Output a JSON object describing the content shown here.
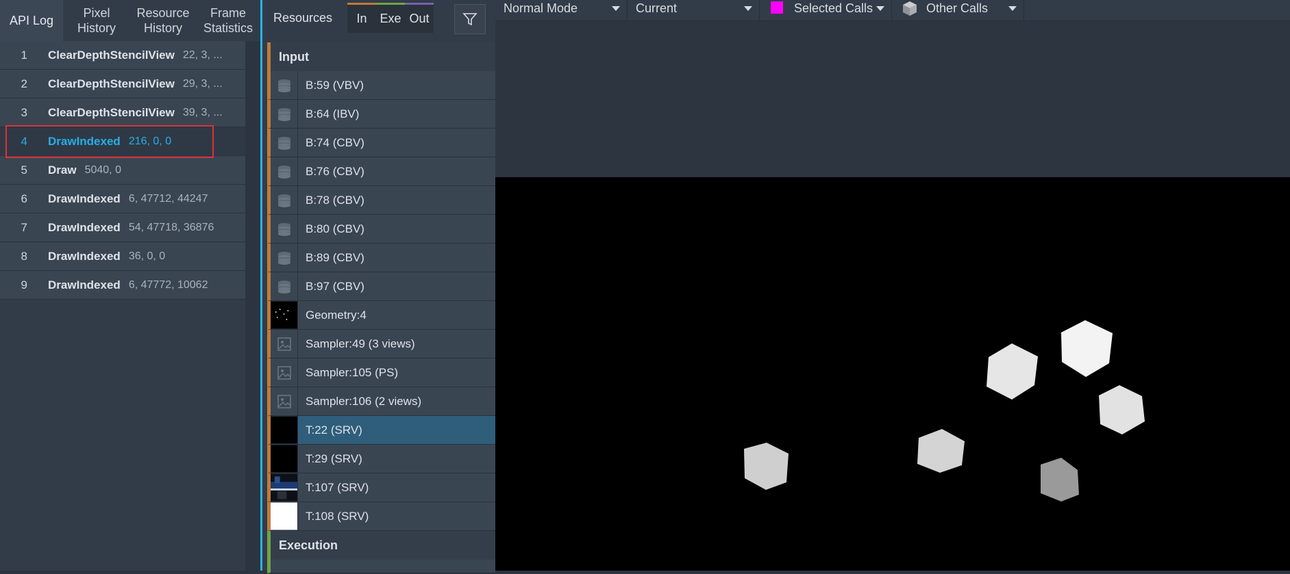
{
  "left_tabs": [
    {
      "label": "API Log"
    },
    {
      "label": "Pixel\nHistory"
    },
    {
      "label": "Resource\nHistory"
    },
    {
      "label": "Frame\nStatistics"
    }
  ],
  "api_calls": [
    {
      "num": "1",
      "fn": "ClearDepthStencilView",
      "args": "22, 3, ..."
    },
    {
      "num": "2",
      "fn": "ClearDepthStencilView",
      "args": "29, 3, ..."
    },
    {
      "num": "3",
      "fn": "ClearDepthStencilView",
      "args": "39, 3, ..."
    },
    {
      "num": "4",
      "fn": "DrawIndexed",
      "args": "216, 0, 0"
    },
    {
      "num": "5",
      "fn": "Draw",
      "args": "5040, 0"
    },
    {
      "num": "6",
      "fn": "DrawIndexed",
      "args": "6, 47712, 44247"
    },
    {
      "num": "7",
      "fn": "DrawIndexed",
      "args": "54, 47718, 36876"
    },
    {
      "num": "8",
      "fn": "DrawIndexed",
      "args": "36, 0, 0"
    },
    {
      "num": "9",
      "fn": "DrawIndexed",
      "args": "6, 47772, 10062"
    }
  ],
  "resources_header": {
    "label": "Resources",
    "tabs": [
      {
        "label": "In",
        "color": "#c27a3a"
      },
      {
        "label": "Exe",
        "color": "#6fa447"
      },
      {
        "label": "Out",
        "color": "#7a5fb0"
      }
    ]
  },
  "input_section": "Input",
  "execution_section": "Execution",
  "resources": [
    {
      "label": "B:59 (VBV)",
      "icon": "buffer-icon"
    },
    {
      "label": "B:64 (IBV)",
      "icon": "buffer-icon"
    },
    {
      "label": "B:74 (CBV)",
      "icon": "buffer-icon"
    },
    {
      "label": "B:76 (CBV)",
      "icon": "buffer-icon"
    },
    {
      "label": "B:78 (CBV)",
      "icon": "buffer-icon"
    },
    {
      "label": "B:80 (CBV)",
      "icon": "buffer-icon"
    },
    {
      "label": "B:89 (CBV)",
      "icon": "buffer-icon"
    },
    {
      "label": "B:97 (CBV)",
      "icon": "buffer-icon"
    },
    {
      "label": "Geometry:4",
      "icon": "geometry-thumbnail"
    },
    {
      "label": "Sampler:49 (3 views)",
      "icon": "image-icon"
    },
    {
      "label": "Sampler:105 (PS)",
      "icon": "image-icon"
    },
    {
      "label": "Sampler:106 (2 views)",
      "icon": "image-icon"
    },
    {
      "label": "T:22 (SRV)",
      "icon": "black-thumbnail"
    },
    {
      "label": "T:29 (SRV)",
      "icon": "black-thumbnail"
    },
    {
      "label": "T:107 (SRV)",
      "icon": "scene-thumbnail"
    },
    {
      "label": "T:108 (SRV)",
      "icon": "white-thumbnail"
    }
  ],
  "toolbar": {
    "mode": "Normal Mode",
    "scope": "Current",
    "selected_calls": "Selected Calls",
    "selected_calls_color": "#ff00ff",
    "other_calls": "Other Calls"
  }
}
